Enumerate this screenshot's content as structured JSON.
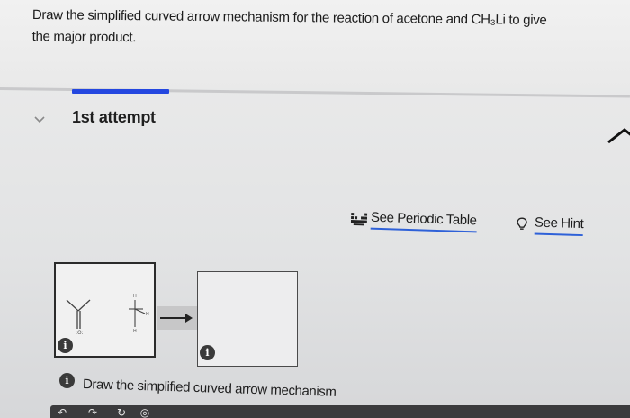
{
  "question": {
    "line1": "Draw the simplified curved arrow mechanism for the reaction of acetone and CH₃Li to give",
    "line2": "the major product."
  },
  "attempt": {
    "toggle_icon": "chevron-down-icon",
    "label": "1st attempt"
  },
  "links": {
    "periodic_table": "See Periodic Table",
    "hint": "See Hint"
  },
  "instruction": "Draw the simplified curved arrow mechanism",
  "colors": {
    "accent_blue": "#2447e0",
    "link_underline": "#2e61d8"
  }
}
